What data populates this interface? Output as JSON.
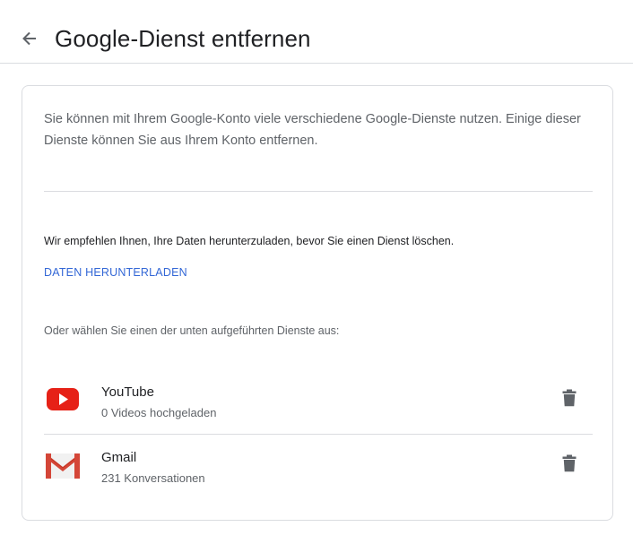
{
  "header": {
    "title": "Google-Dienst entfernen",
    "back_icon": "arrow-left-icon"
  },
  "card": {
    "intro": "Sie können mit Ihrem Google-Konto viele verschiedene Google-Dienste nutzen. Einige dieser Dienste können Sie aus Ihrem Konto entfernen.",
    "recommendation": "Wir empfehlen Ihnen, Ihre Daten herunterzuladen, bevor Sie einen Dienst löschen.",
    "download_link": "DATEN HERUNTERLADEN",
    "choose_prompt": "Oder wählen Sie einen der unten aufgeführten Dienste aus:",
    "services": [
      {
        "name": "YouTube",
        "detail": "0 Videos hochgeladen",
        "icon": "youtube-icon",
        "action_icon": "trash-icon"
      },
      {
        "name": "Gmail",
        "detail": "231 Konversationen",
        "icon": "gmail-icon",
        "action_icon": "trash-icon"
      }
    ]
  },
  "colors": {
    "link": "#3367d6",
    "youtube_red": "#e62117",
    "gmail_red": "#d44638",
    "divider": "#dadce0",
    "secondary_text": "#5f6368"
  }
}
